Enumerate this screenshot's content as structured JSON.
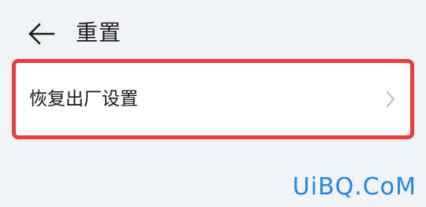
{
  "header": {
    "title": "重置",
    "back_icon": "back-arrow-icon"
  },
  "settings": {
    "items": [
      {
        "label": "恢复出厂设置",
        "icon": "chevron-right-icon"
      }
    ],
    "highlight_color": "#ee3b3b"
  },
  "watermark": {
    "text": "UiBQ.CoM",
    "color": "#1e87ea"
  }
}
